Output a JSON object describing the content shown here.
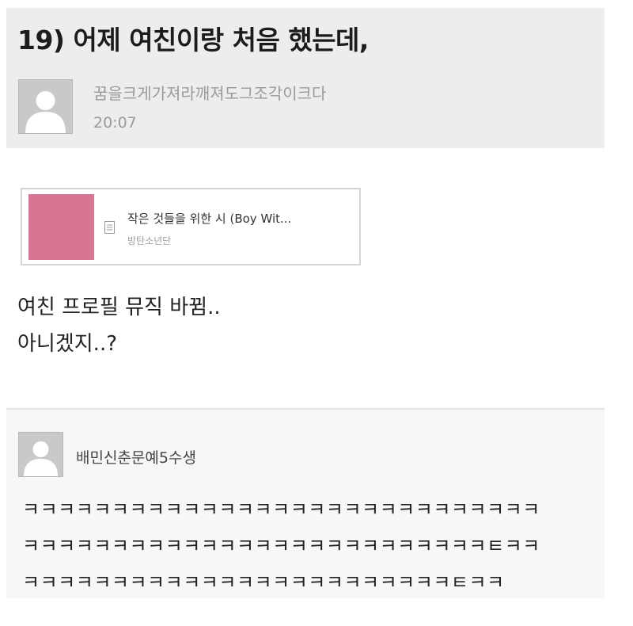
{
  "post": {
    "title": "19) 어제 여친이랑 처음 했는데,",
    "author": "꿈을크게가져라깨져도그조각이크다",
    "time": "20:07"
  },
  "music_card": {
    "song_title": "작은 것들을 위한 시 (Boy Wit...",
    "artist": "방탄소년단",
    "album_color": "#d87592"
  },
  "body": {
    "line1": "여친 프로필 뮤직 바뀜..",
    "line2": "아니겠지..?"
  },
  "comment": {
    "author": "배민신춘문예5수생",
    "lines": [
      "ㅋㅋㅋㅋㅋㅋㅋㅋㅋㅋㅋㅋㅋㅋㅋㅋㅋㅋㅋㅋㅋㅋㅋㅋㅋㅋㅋㅋㅋ",
      "ㅋㅋㅋㅋㅋㅋㅋㅋㅋㅋㅋㅋㅋㅋㅋㅋㅋㅋㅋㅋㅋㅋㅋㅋㅋㅋㅌㅋㅋ",
      "ㅋㅋㅋㅋㅋㅋㅋㅋㅋㅋㅋㅋㅋㅋㅋㅋㅋㅋㅋㅋㅋㅋㅋㅋㅌㅋㅋ"
    ]
  },
  "icons": {
    "header_avatar": "default-user-icon",
    "music_doc": "document-icon",
    "comment_avatar": "default-user-icon"
  }
}
